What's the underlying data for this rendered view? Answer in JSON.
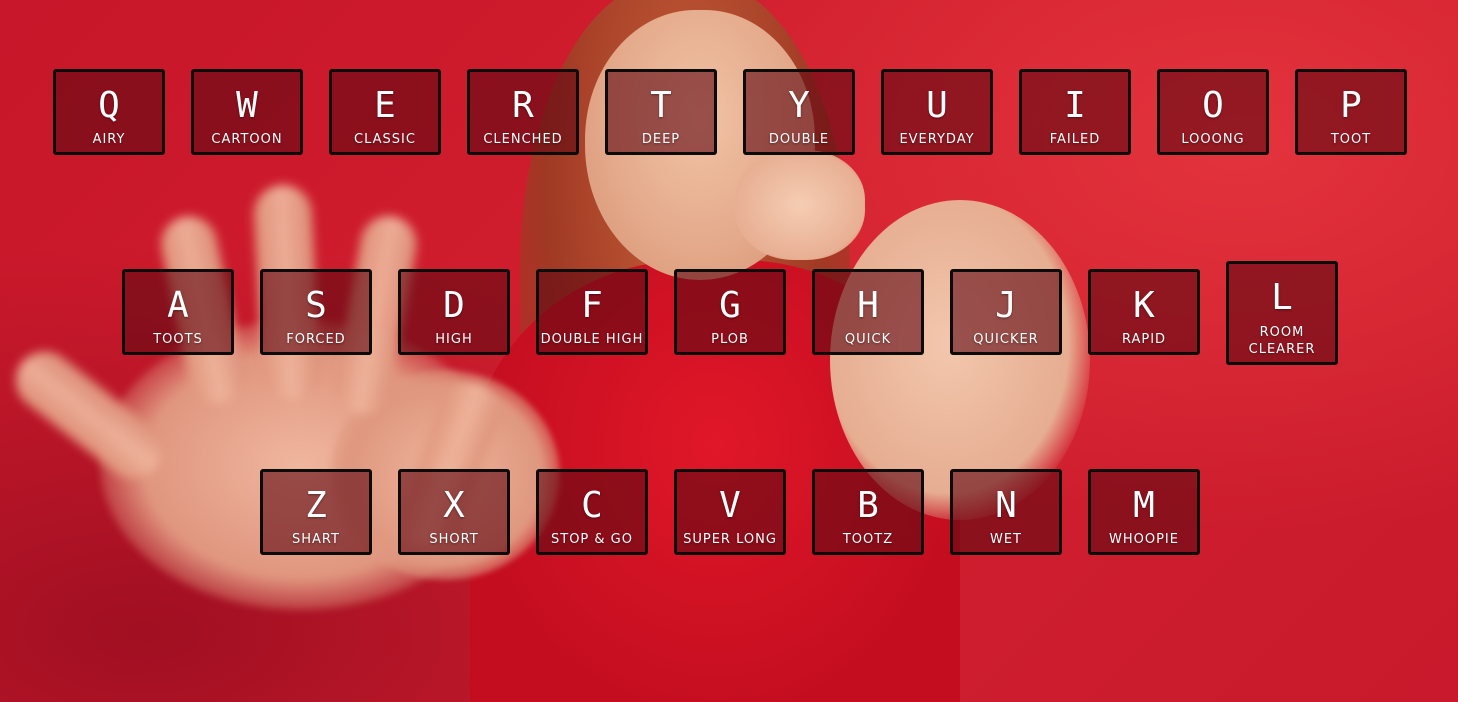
{
  "keyboard": {
    "row1": [
      {
        "key": "Q",
        "sound": "AIRY"
      },
      {
        "key": "W",
        "sound": "CARTOON"
      },
      {
        "key": "E",
        "sound": "CLASSIC"
      },
      {
        "key": "R",
        "sound": "CLENCHED"
      },
      {
        "key": "T",
        "sound": "DEEP"
      },
      {
        "key": "Y",
        "sound": "DOUBLE"
      },
      {
        "key": "U",
        "sound": "EVERYDAY"
      },
      {
        "key": "I",
        "sound": "FAILED"
      },
      {
        "key": "O",
        "sound": "LOOONG"
      },
      {
        "key": "P",
        "sound": "TOOT"
      }
    ],
    "row2": [
      {
        "key": "A",
        "sound": "TOOTS"
      },
      {
        "key": "S",
        "sound": "FORCED"
      },
      {
        "key": "D",
        "sound": "HIGH"
      },
      {
        "key": "F",
        "sound": "DOUBLE HIGH"
      },
      {
        "key": "G",
        "sound": "PLOB"
      },
      {
        "key": "H",
        "sound": "QUICK"
      },
      {
        "key": "J",
        "sound": "QUICKER"
      },
      {
        "key": "K",
        "sound": "RAPID"
      },
      {
        "key": "L",
        "sound": "ROOM CLEARER"
      }
    ],
    "row3": [
      {
        "key": "Z",
        "sound": "SHART"
      },
      {
        "key": "X",
        "sound": "SHORT"
      },
      {
        "key": "C",
        "sound": "STOP & GO"
      },
      {
        "key": "V",
        "sound": "SUPER LONG"
      },
      {
        "key": "B",
        "sound": "TOOTZ"
      },
      {
        "key": "N",
        "sound": "WET"
      },
      {
        "key": "M",
        "sound": "WHOOPIE"
      }
    ]
  }
}
